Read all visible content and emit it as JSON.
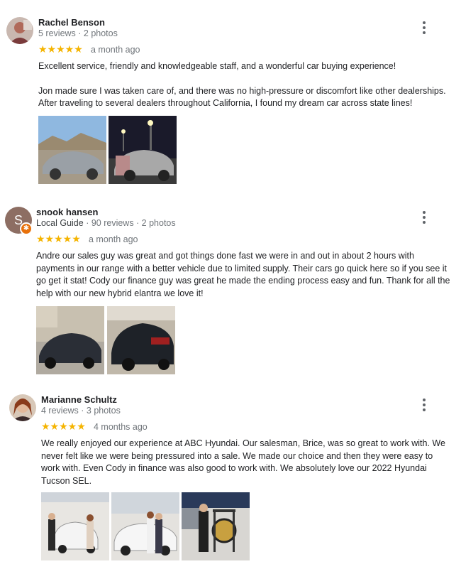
{
  "reviews": [
    {
      "name": "Rachel Benson",
      "meta": "5 reviews · 2 photos",
      "rating": 5,
      "stars": "★★★★★",
      "time": "a month ago",
      "paragraphs": [
        "Excellent service, friendly and knowledgeable staff, and a wonderful car buying experience!",
        "Jon made sure I was taken care of, and there was no high-pressure or discomfort like other dealerships. After traveling to several dealers throughout California, I found my dream car across state lines!"
      ]
    },
    {
      "name": "snook hansen",
      "avatar_letter": "S",
      "local_guide": "Local Guide",
      "meta": " · 90 reviews · 2 photos",
      "rating": 5,
      "stars": "★★★★★",
      "time": "a month ago",
      "paragraphs": [
        "Andre our sales guy was great and got things done fast we were in and out in about 2 hours with payments in our range with a better vehicle due to limited supply. Their cars go quick here so if you see it go get it stat! Cody our finance guy was great he made the ending process easy and fun. Thank for all the help with our new hybrid elantra we love it!"
      ]
    },
    {
      "name": "Marianne Schultz",
      "meta": "4 reviews · 3 photos",
      "rating": 5,
      "stars": "★★★★★",
      "time": "4 months ago",
      "paragraphs": [
        "We really enjoyed our experience at ABC Hyundai. Our salesman, Brice, was so great to work with. We never felt like we were being pressured into a sale. We made our choice and then they were easy to work with. Even Cody in finance was also good to work with. We absolutely love our 2022 Hyundai Tucson SEL."
      ]
    }
  ],
  "colors": {
    "star": "#f5b400",
    "meta": "#70757a",
    "guide_badge": "#e8710a"
  },
  "icons": {
    "more": "more-vert-icon",
    "guide": "local-guide-star-icon"
  }
}
